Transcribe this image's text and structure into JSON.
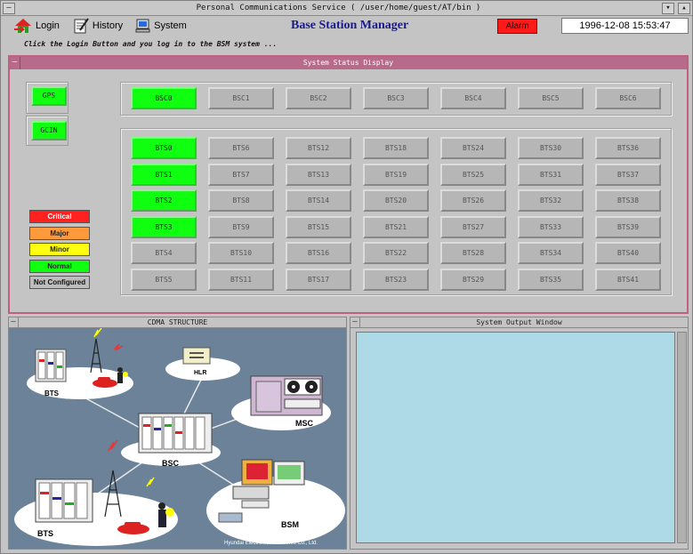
{
  "window": {
    "title": "Personal Communications Service ( /user/home/guest/AT/bin )"
  },
  "toolbar": {
    "login": "Login",
    "history": "History",
    "system": "System"
  },
  "app_title": "Base Station Manager",
  "alarm": {
    "label": "Alarm",
    "color": "#ff1a1a"
  },
  "clock": "1996-12-08 15:53:47",
  "hint": "Click the Login Button and you log in to the BSM system ...",
  "status_panel": {
    "title": "System Status Display"
  },
  "side_buttons": [
    "GPS",
    "GCIN"
  ],
  "bsc_row": [
    {
      "label": "BSC0",
      "status": "normal"
    },
    {
      "label": "BSC1",
      "status": "off"
    },
    {
      "label": "BSC2",
      "status": "off"
    },
    {
      "label": "BSC3",
      "status": "off"
    },
    {
      "label": "BSC4",
      "status": "off"
    },
    {
      "label": "BSC5",
      "status": "off"
    },
    {
      "label": "BSC6",
      "status": "off"
    }
  ],
  "bts_grid": [
    [
      "BTS0",
      "BTS6",
      "BTS12",
      "BTS18",
      "BTS24",
      "BTS30",
      "BTS36"
    ],
    [
      "BTS1",
      "BTS7",
      "BTS13",
      "BTS19",
      "BTS25",
      "BTS31",
      "BTS37"
    ],
    [
      "BTS2",
      "BTS8",
      "BTS14",
      "BTS20",
      "BTS26",
      "BTS32",
      "BTS38"
    ],
    [
      "BTS3",
      "BTS9",
      "BTS15",
      "BTS21",
      "BTS27",
      "BTS33",
      "BTS39"
    ],
    [
      "BTS4",
      "BTS10",
      "BTS16",
      "BTS22",
      "BTS28",
      "BTS34",
      "BTS40"
    ],
    [
      "BTS5",
      "BTS11",
      "BTS17",
      "BTS23",
      "BTS29",
      "BTS35",
      "BTS41"
    ]
  ],
  "bts_active": [
    "BTS0",
    "BTS1",
    "BTS2",
    "BTS3"
  ],
  "legend": [
    {
      "label": "Critical",
      "color": "#ff2020",
      "text": "#ffffff"
    },
    {
      "label": "Major",
      "color": "#ff9a3c",
      "text": "#222222"
    },
    {
      "label": "Minor",
      "color": "#ffff10",
      "text": "#222222"
    },
    {
      "label": "Normal",
      "color": "#10ff10",
      "text": "#222222"
    },
    {
      "label": "Not Configured",
      "color": "#bdbdbd",
      "text": "#111111"
    }
  ],
  "cdma": {
    "title": "CDMA STRUCTURE",
    "labels": {
      "bts_top": "BTS",
      "hlr": "HLR",
      "msc": "MSC",
      "bsc": "BSC",
      "bts_bottom": "BTS",
      "bsm": "BSM"
    },
    "credit": "Hyundai Electronics Industries Co., Ltd."
  },
  "output": {
    "title": "System Output Window"
  },
  "colors": {
    "panel_header": "#b86a8a",
    "active": "#10ff10",
    "inactive": "#b6b6b6",
    "output_bg": "#aed9e6",
    "cdma_bg": "#6b8298"
  }
}
